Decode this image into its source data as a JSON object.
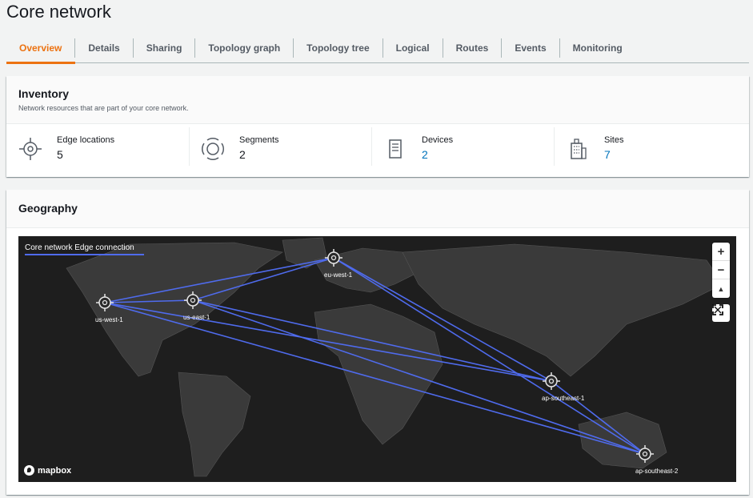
{
  "page": {
    "title": "Core network"
  },
  "tabs": [
    {
      "label": "Overview",
      "active": true
    },
    {
      "label": "Details"
    },
    {
      "label": "Sharing"
    },
    {
      "label": "Topology graph"
    },
    {
      "label": "Topology tree"
    },
    {
      "label": "Logical"
    },
    {
      "label": "Routes"
    },
    {
      "label": "Events"
    },
    {
      "label": "Monitoring"
    }
  ],
  "inventory": {
    "title": "Inventory",
    "description": "Network resources that are part of your core network.",
    "stats": [
      {
        "label": "Edge locations",
        "value": "5",
        "icon": "edge-location-icon",
        "link": false
      },
      {
        "label": "Segments",
        "value": "2",
        "icon": "segments-icon",
        "link": false
      },
      {
        "label": "Devices",
        "value": "2",
        "icon": "devices-icon",
        "link": true
      },
      {
        "label": "Sites",
        "value": "7",
        "icon": "sites-icon",
        "link": true
      }
    ]
  },
  "geography": {
    "title": "Geography",
    "legend": "Core network Edge connection",
    "attribution": "mapbox",
    "colors": {
      "connection": "#4f6bed",
      "accent": "#ec7211",
      "link": "#0073bb"
    },
    "edge_locations": [
      "us-west-1",
      "us-east-1",
      "eu-west-1",
      "ap-southeast-1",
      "ap-southeast-2"
    ],
    "connections": [
      [
        "us-west-1",
        "us-east-1"
      ],
      [
        "us-west-1",
        "eu-west-1"
      ],
      [
        "us-west-1",
        "ap-southeast-1"
      ],
      [
        "us-west-1",
        "ap-southeast-2"
      ],
      [
        "us-east-1",
        "eu-west-1"
      ],
      [
        "us-east-1",
        "ap-southeast-1"
      ],
      [
        "us-east-1",
        "ap-southeast-2"
      ],
      [
        "eu-west-1",
        "ap-southeast-1"
      ],
      [
        "eu-west-1",
        "ap-southeast-2"
      ],
      [
        "ap-southeast-1",
        "ap-southeast-2"
      ]
    ],
    "controls": {
      "zoom_in": "+",
      "zoom_out": "−",
      "compass": "▲"
    }
  }
}
